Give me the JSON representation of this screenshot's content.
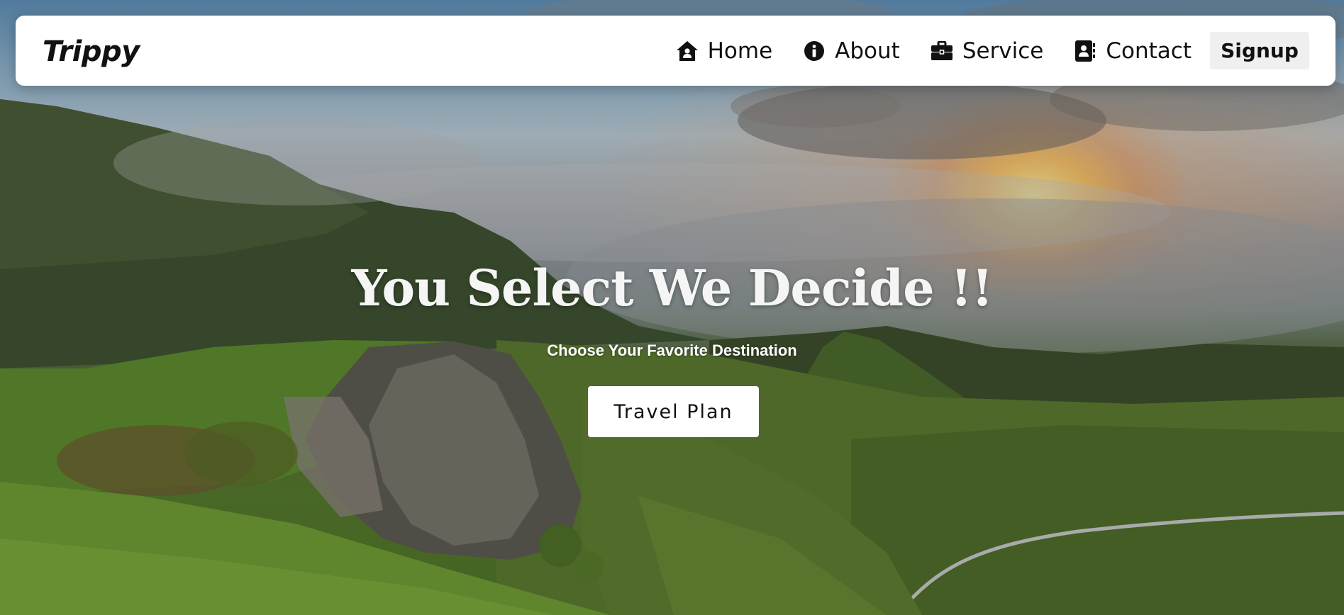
{
  "brand": {
    "name": "Trippy"
  },
  "nav": {
    "items": [
      {
        "label": "Home",
        "icon": "house-user-icon"
      },
      {
        "label": "About",
        "icon": "info-circle-icon"
      },
      {
        "label": "Service",
        "icon": "briefcase-icon"
      },
      {
        "label": "Contact",
        "icon": "address-book-icon"
      }
    ],
    "signup_label": "Signup"
  },
  "hero": {
    "headline": "You Select We Decide !!",
    "subheadline": "Choose Your Favorite Destination",
    "cta_label": "Travel Plan"
  }
}
